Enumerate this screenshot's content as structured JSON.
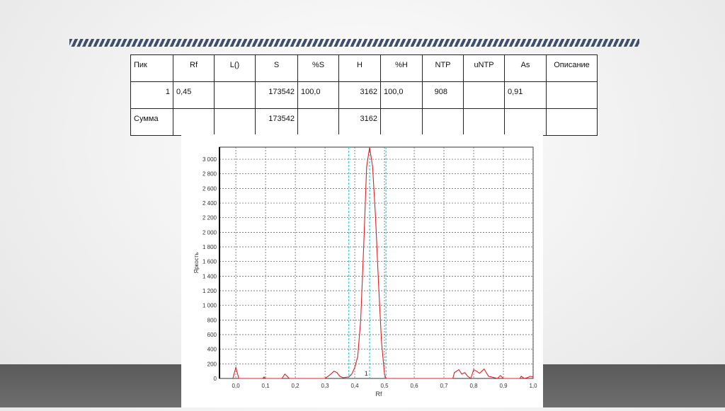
{
  "table": {
    "headers": [
      "Пик",
      "Rf",
      "L()",
      "S",
      "%S",
      "H",
      "%H",
      "NTP",
      "uNTP",
      "As",
      "Описание"
    ],
    "rows": [
      [
        "1",
        "0,45",
        "",
        "173542",
        "100,0",
        "3162",
        "100,0",
        "908",
        "",
        "0,91",
        ""
      ],
      [
        "Сумма",
        "",
        "",
        "173542",
        "",
        "3162",
        "",
        "",
        "",
        "",
        ""
      ]
    ]
  },
  "chart_data": {
    "type": "line",
    "title": "",
    "xlabel": "Rf",
    "ylabel": "Яркость",
    "xlim": [
      -0.055,
      1.0
    ],
    "ylim": [
      0,
      3165
    ],
    "grid": true,
    "xticks": [
      "0,0",
      "0,1",
      "0,2",
      "0,3",
      "0,4",
      "0,5",
      "0,6",
      "0,7",
      "0,8",
      "0,9",
      "1,0"
    ],
    "yticks": [
      "0",
      "200",
      "400",
      "600",
      "800",
      "1 000",
      "1 200",
      "1 400",
      "1 600",
      "1 800",
      "2 000",
      "2 200",
      "2 400",
      "2 600",
      "2 800",
      "3 000"
    ],
    "series": [
      {
        "name": "Яркость",
        "color": "#e02020",
        "x": [
          -0.01,
          0.0,
          0.01,
          0.09,
          0.095,
          0.1,
          0.155,
          0.165,
          0.18,
          0.3,
          0.31,
          0.32,
          0.33,
          0.34,
          0.35,
          0.36,
          0.38,
          0.39,
          0.4,
          0.41,
          0.42,
          0.43,
          0.44,
          0.45,
          0.46,
          0.47,
          0.48,
          0.49,
          0.5,
          0.505,
          0.73,
          0.735,
          0.75,
          0.76,
          0.77,
          0.78,
          0.79,
          0.8,
          0.81,
          0.82,
          0.835,
          0.85,
          0.87,
          0.88,
          0.89,
          0.9,
          0.955,
          0.96,
          0.97,
          0.98,
          0.99,
          1.0
        ],
        "y": [
          0,
          150,
          0,
          0,
          20,
          0,
          0,
          60,
          0,
          0,
          30,
          60,
          100,
          80,
          30,
          10,
          20,
          60,
          150,
          300,
          800,
          1800,
          2900,
          3162,
          2900,
          2200,
          1300,
          500,
          60,
          0,
          0,
          80,
          120,
          60,
          80,
          30,
          0,
          120,
          100,
          70,
          130,
          30,
          10,
          0,
          40,
          0,
          0,
          30,
          0,
          10,
          30,
          20
        ]
      }
    ],
    "markers": {
      "color": "#30d0e0",
      "x": [
        0.38,
        0.45,
        0.505
      ]
    },
    "annotations": [
      {
        "text": "1",
        "x": 0.44,
        "y": 0
      }
    ]
  }
}
